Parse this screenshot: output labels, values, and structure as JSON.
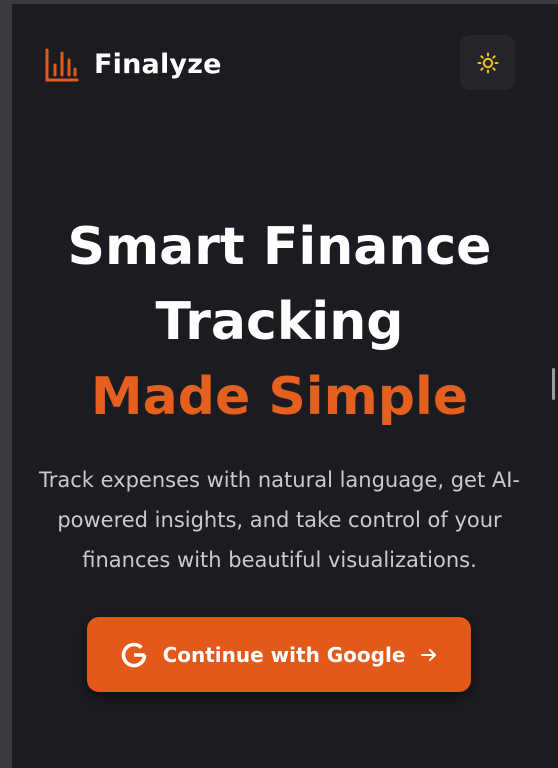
{
  "header": {
    "brand_name": "Finalyze",
    "logo_icon": "bar-chart-icon",
    "theme_toggle_icon": "sun-icon"
  },
  "hero": {
    "title_line1": "Smart Finance",
    "title_line2": "Tracking",
    "title_accent": "Made Simple",
    "description": "Track expenses with natural language, get AI-powered insights, and take control of your finances with beautiful visualizations."
  },
  "cta": {
    "label": "Continue with Google",
    "leading_icon": "google-icon",
    "trailing_icon": "arrow-right-icon"
  },
  "colors": {
    "background": "#1a1c22",
    "accent": "#e2591a",
    "accent_text": "#e5601f",
    "sun_icon": "#f5c518"
  }
}
